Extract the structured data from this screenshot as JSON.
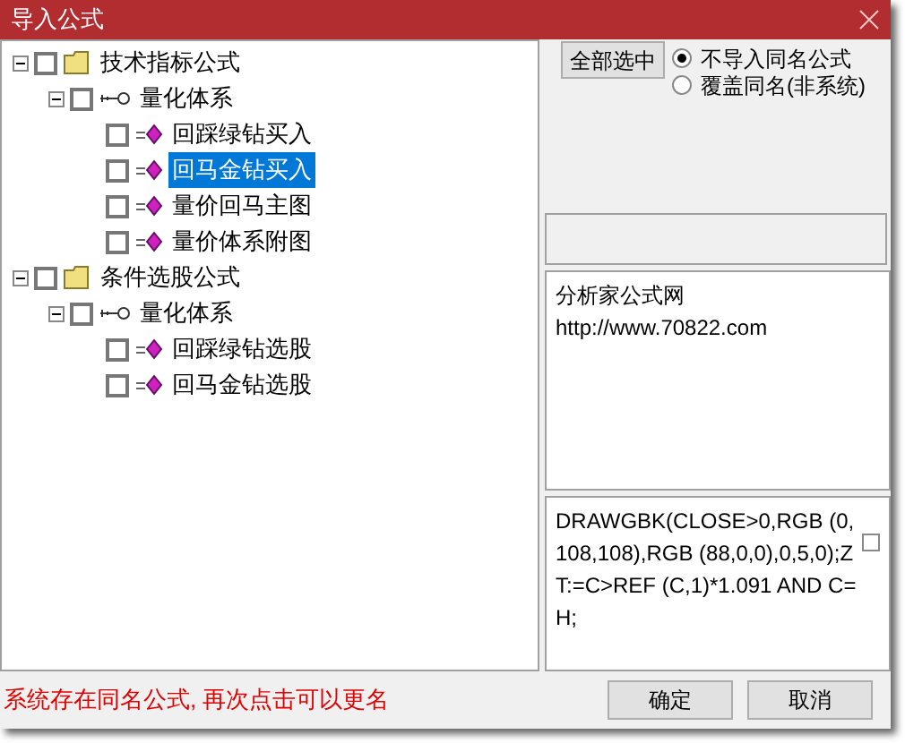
{
  "window": {
    "title": "导入公式"
  },
  "tree": [
    {
      "kind": "folder",
      "label": "技术指标公式",
      "checked": false,
      "expanded": true,
      "selected": false,
      "children": [
        {
          "kind": "group",
          "label": "量化体系",
          "checked": false,
          "expanded": true,
          "selected": false,
          "children": [
            {
              "kind": "formula",
              "label": "回踩绿钻买入",
              "checked": false,
              "selected": false
            },
            {
              "kind": "formula",
              "label": "回马金钻买入",
              "checked": false,
              "selected": true
            },
            {
              "kind": "formula",
              "label": "量价回马主图",
              "checked": false,
              "selected": false
            },
            {
              "kind": "formula",
              "label": "量价体系附图",
              "checked": false,
              "selected": false
            }
          ]
        }
      ]
    },
    {
      "kind": "folder",
      "label": "条件选股公式",
      "checked": false,
      "expanded": true,
      "selected": false,
      "children": [
        {
          "kind": "group",
          "label": "量化体系",
          "checked": false,
          "expanded": true,
          "selected": false,
          "children": [
            {
              "kind": "formula",
              "label": "回踩绿钻选股",
              "checked": false,
              "selected": false
            },
            {
              "kind": "formula",
              "label": "回马金钻选股",
              "checked": false,
              "selected": false
            }
          ]
        }
      ]
    }
  ],
  "select_all_button": "全部选中",
  "options": [
    {
      "label": "不导入同名公式",
      "selected": true
    },
    {
      "label": "覆盖同名(非系统)",
      "selected": false
    }
  ],
  "description": [
    "分析家公式网",
    "http://www.70822.com"
  ],
  "source_code": "DRAWGBK(CLOSE>0,RGB (0,108,108),RGB (88,0,0),0,5,0);ZT:=C>REF (C,1)*1.091 AND C=H;",
  "source_checkbox": {
    "checked": false
  },
  "buttons": [
    "确定",
    "取消"
  ],
  "status": "系统存在同名公式, 再次点击可以更名"
}
